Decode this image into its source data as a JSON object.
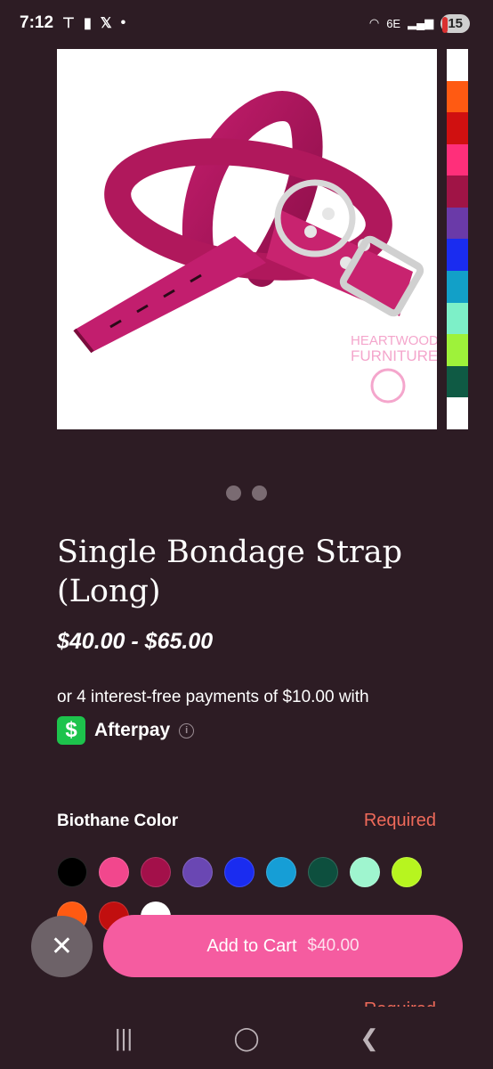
{
  "status_bar": {
    "time": "7:12",
    "network": "6E",
    "battery": "15"
  },
  "product": {
    "title": "Single Bondage Strap (Long)",
    "price_range": "$40.00 - $65.00",
    "image_watermark": "HEARTWOODS FURNITURE",
    "gallery_page_count": 2
  },
  "payment": {
    "installments_text": "or 4 interest-free payments of $10.00 with",
    "provider": "Afterpay",
    "provider_icon": "$"
  },
  "options": {
    "color_label": "Biothane Color",
    "color_required": "Required",
    "swatch_colors": [
      "#000000",
      "#f2478d",
      "#a3104a",
      "#6a47b3",
      "#1a2cf0",
      "#169ed6",
      "#0d4f3e",
      "#9ff5cf",
      "#b7f51f",
      "#ff5a12",
      "#c10f0f",
      "#ffffff"
    ],
    "peek_colors": [
      "#ffffff",
      "#ff5a12",
      "#d01010",
      "#ff2f7a",
      "#a01446",
      "#6a3aa8",
      "#1a2cf0",
      "#12a0c8",
      "#7df0c8",
      "#9ef23a",
      "#0f5a44",
      "#ffffff"
    ]
  },
  "actions": {
    "cart_label": "Add to Cart",
    "cart_price": "$40.00"
  },
  "icons": {
    "close": "close-icon",
    "nav_recent": "recent-apps-icon",
    "nav_home": "home-icon",
    "nav_back": "back-icon"
  }
}
